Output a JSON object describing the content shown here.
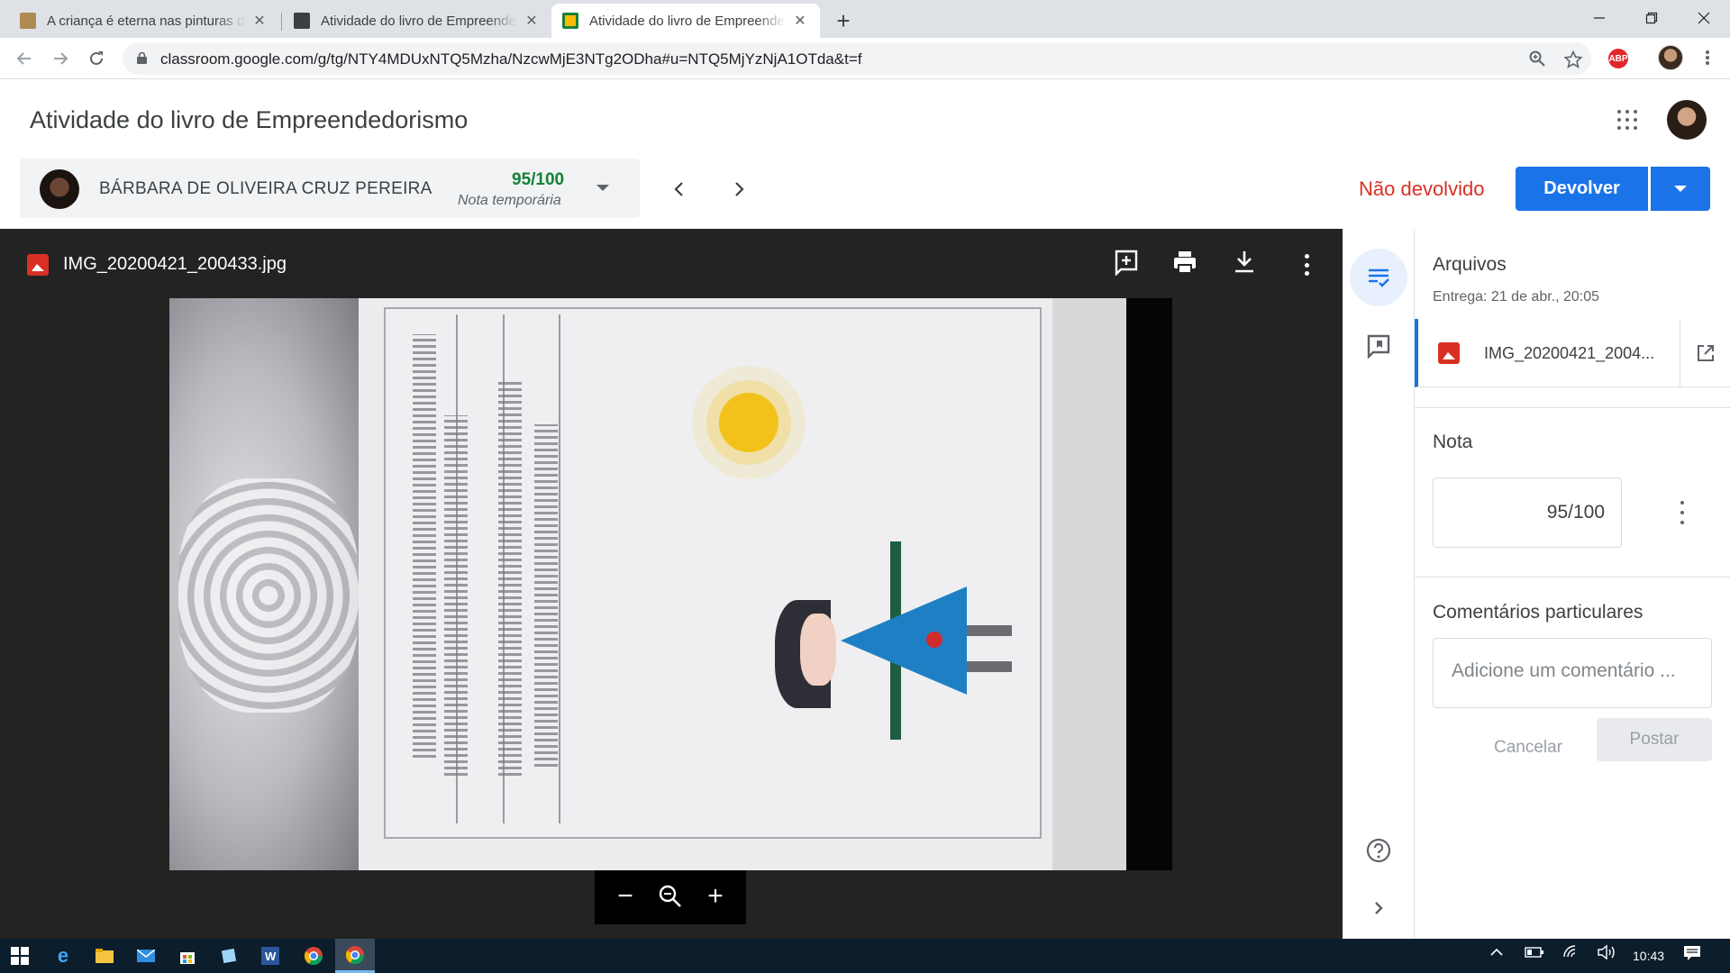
{
  "browser": {
    "tabs": [
      {
        "title": "A criança é eterna nas pinturas de",
        "active": false
      },
      {
        "title": "Atividade do livro de Empreendedorismo",
        "active": false
      },
      {
        "title": "Atividade do livro de Empreendedorismo",
        "active": true
      }
    ],
    "new_tab": "+",
    "close": "✕",
    "url": "classroom.google.com/g/tg/NTY4MDUxNTQ5Mzha/NzcwMjE3NTg2ODha#u=NTQ5MjYzNjA1OTda&t=f",
    "extension_label": "ABP"
  },
  "header": {
    "title": "Atividade do livro de Empreendedorismo"
  },
  "student": {
    "name": "BÁRBARA DE OLIVEIRA CRUZ PEREIRA",
    "grade": "95/100",
    "grade_note": "Nota temporária"
  },
  "actions": {
    "status": "Não devolvido",
    "return_label": "Devolver"
  },
  "viewer": {
    "file_name": "IMG_20200421_200433.jpg",
    "zoom_minus": "−",
    "zoom_plus": "+"
  },
  "panel": {
    "files_heading": "Arquivos",
    "due": "Entrega: 21 de abr., 20:05",
    "file_name": "IMG_20200421_2004...",
    "grade_heading": "Nota",
    "grade_value": "95/100",
    "comments_heading": "Comentários particulares",
    "comment_placeholder": "Adicione um comentário ...",
    "cancel_label": "Cancelar",
    "post_label": "Postar"
  },
  "taskbar": {
    "time": "10:43"
  },
  "colors": {
    "accent": "#1a73e8",
    "status_red": "#d93025",
    "grade_green": "#188038"
  }
}
